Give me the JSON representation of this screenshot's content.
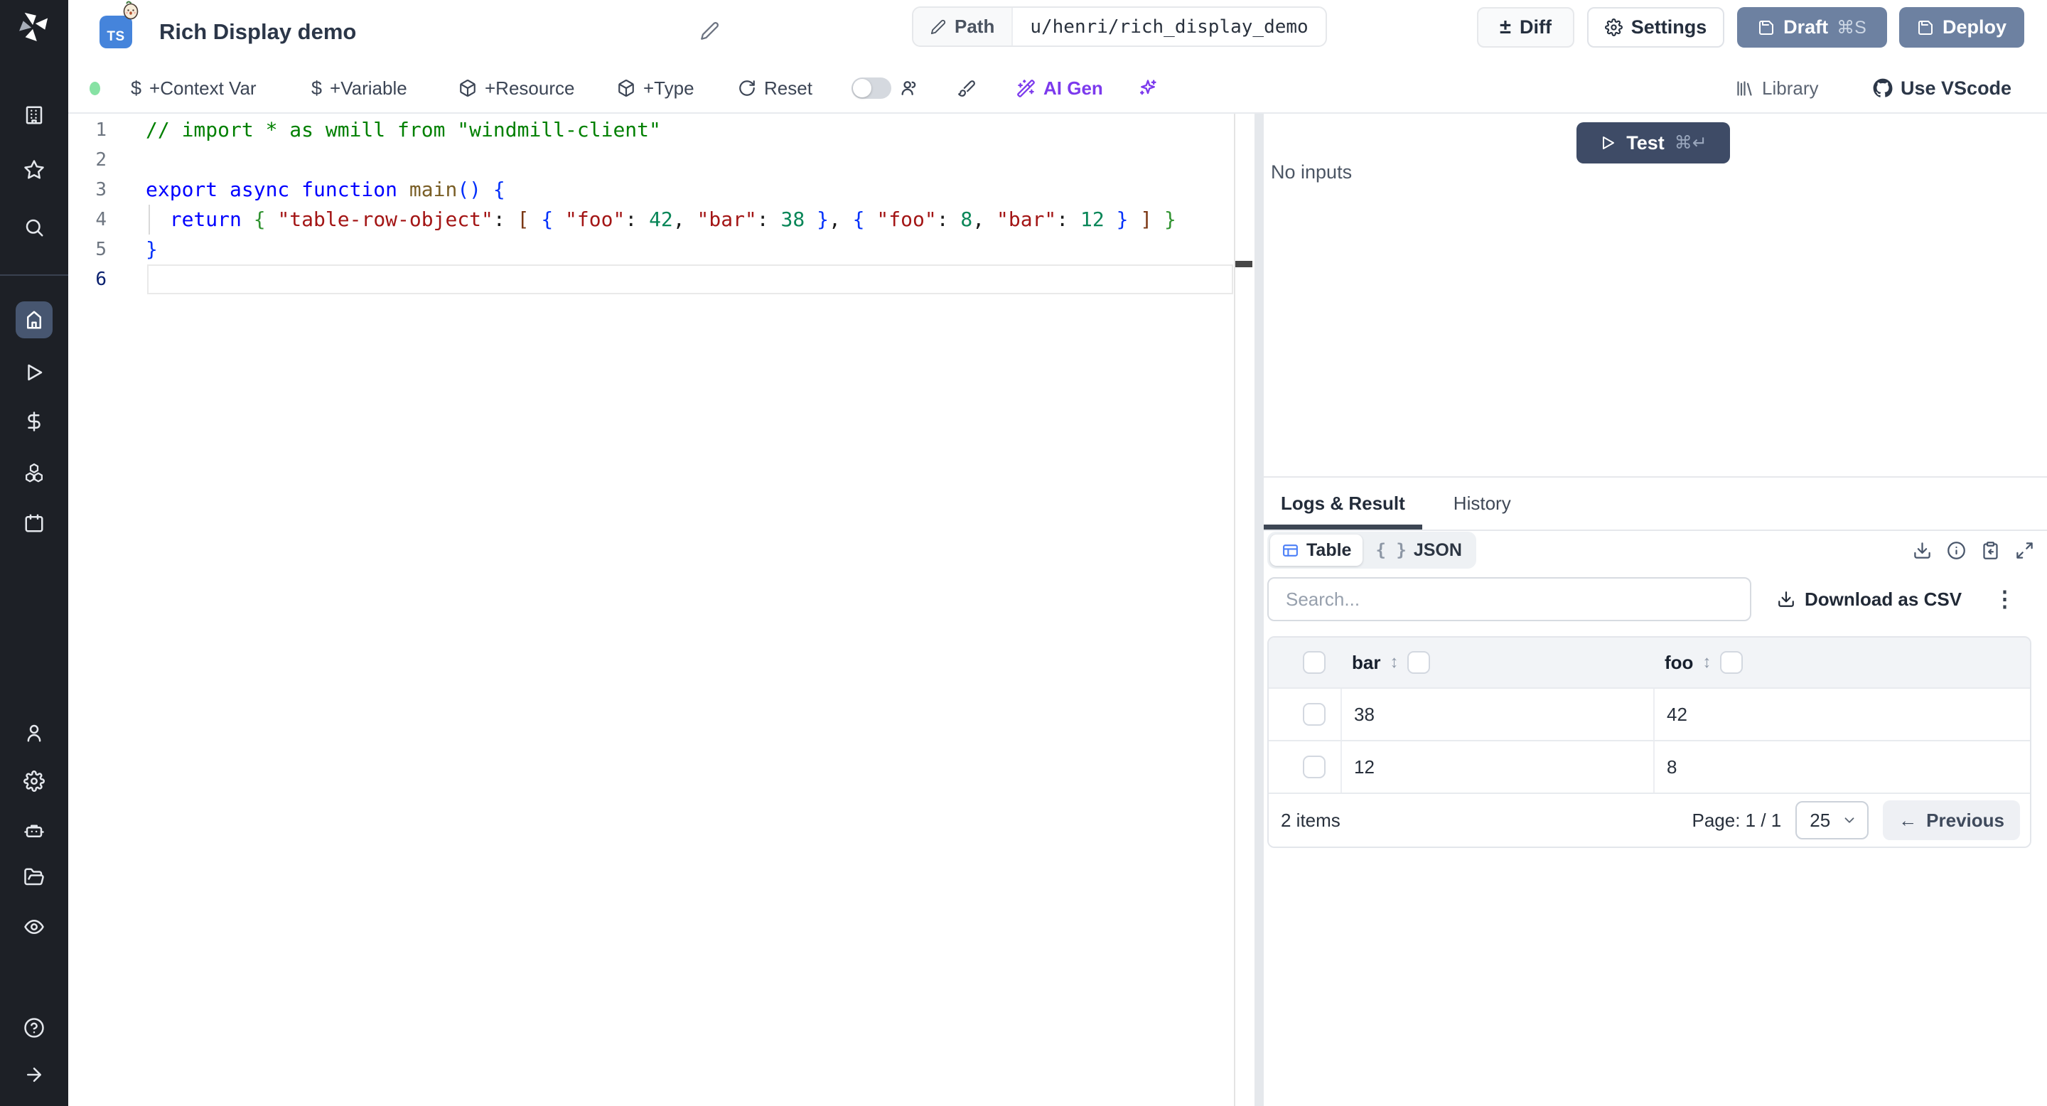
{
  "header": {
    "lang_badge": "TS",
    "title": "Rich Display demo",
    "path_label": "Path",
    "path_value": "u/henri/rich_display_demo",
    "diff": "Diff",
    "settings": "Settings",
    "draft": "Draft",
    "draft_shortcut": "⌘S",
    "deploy": "Deploy"
  },
  "toolbar": {
    "context_var": "+Context Var",
    "variable": "+Variable",
    "resource": "+Resource",
    "type": "+Type",
    "reset": "Reset",
    "ai_gen": "AI Gen",
    "library": "Library",
    "use_vscode": "Use VScode"
  },
  "editor": {
    "line_numbers": [
      "1",
      "2",
      "3",
      "4",
      "5",
      "6"
    ],
    "active_line": 6,
    "lines": [
      [
        [
          "comment",
          "// import * as wmill from \"windmill-client\""
        ]
      ],
      [],
      [
        [
          "keyword",
          "export async function "
        ],
        [
          "function",
          "main"
        ],
        [
          "b1",
          "()"
        ],
        [
          "plain",
          " "
        ],
        [
          "b1",
          "{"
        ]
      ],
      [
        [
          "plain",
          "  "
        ],
        [
          "keyword",
          "return"
        ],
        [
          "plain",
          " "
        ],
        [
          "b2",
          "{"
        ],
        [
          "plain",
          " "
        ],
        [
          "string",
          "\"table-row-object\""
        ],
        [
          "plain",
          ": "
        ],
        [
          "b3",
          "["
        ],
        [
          "plain",
          " "
        ],
        [
          "b1",
          "{"
        ],
        [
          "plain",
          " "
        ],
        [
          "string",
          "\"foo\""
        ],
        [
          "plain",
          ": "
        ],
        [
          "number",
          "42"
        ],
        [
          "plain",
          ", "
        ],
        [
          "string",
          "\"bar\""
        ],
        [
          "plain",
          ": "
        ],
        [
          "number",
          "38"
        ],
        [
          "plain",
          " "
        ],
        [
          "b1",
          "}"
        ],
        [
          "plain",
          ", "
        ],
        [
          "b1",
          "{"
        ],
        [
          "plain",
          " "
        ],
        [
          "string",
          "\"foo\""
        ],
        [
          "plain",
          ": "
        ],
        [
          "number",
          "8"
        ],
        [
          "plain",
          ", "
        ],
        [
          "string",
          "\"bar\""
        ],
        [
          "plain",
          ": "
        ],
        [
          "number",
          "12"
        ],
        [
          "plain",
          " "
        ],
        [
          "b1",
          "}"
        ],
        [
          "plain",
          " "
        ],
        [
          "b3",
          "]"
        ],
        [
          "plain",
          " "
        ],
        [
          "b2",
          "}"
        ]
      ],
      [
        [
          "b1",
          "}"
        ]
      ],
      []
    ]
  },
  "run_panel": {
    "no_inputs": "No inputs",
    "test": "Test",
    "test_shortcut": "⌘↵"
  },
  "result_panel": {
    "tabs": [
      {
        "label": "Logs & Result"
      },
      {
        "label": "History"
      }
    ],
    "view_table": "Table",
    "view_json": "JSON",
    "search_placeholder": "Search...",
    "download_csv": "Download as CSV",
    "table": {
      "columns": [
        "bar",
        "foo"
      ],
      "rows": [
        [
          "38",
          "42"
        ],
        [
          "12",
          "8"
        ]
      ],
      "items_count": "2 items",
      "page": "Page: 1 / 1",
      "page_size": "25",
      "previous": "Previous"
    }
  },
  "icons": {
    "plus_minus": "±",
    "dollar": "$",
    "sort": "↕",
    "braces": "{ }",
    "kebab": "⋮",
    "arrow_left": "←"
  }
}
